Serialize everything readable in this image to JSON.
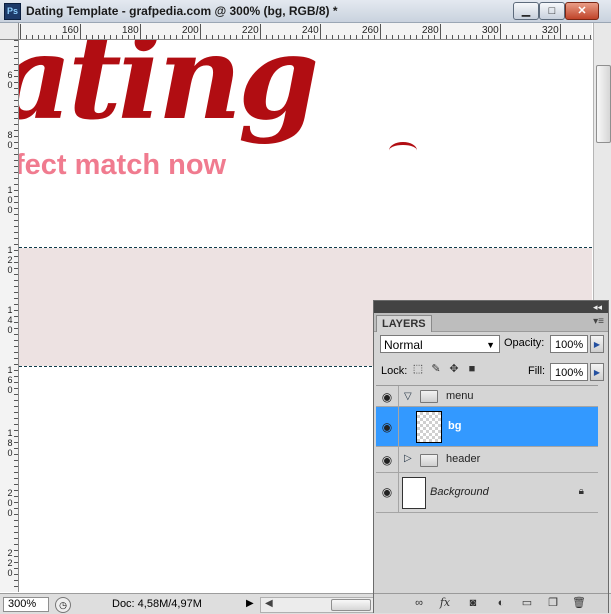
{
  "window": {
    "app_icon": "Ps",
    "title": "Dating Template - grafpedia.com @ 300% (bg, RGB/8) *",
    "buttons": {
      "minimize": "▁",
      "maximize": "□",
      "close": "✕"
    }
  },
  "ruler_top": {
    "labels": [
      "160",
      "180",
      "200",
      "220",
      "240",
      "260",
      "280",
      "300",
      "320"
    ]
  },
  "ruler_left": {
    "labels": [
      "60",
      "80",
      "100",
      "120",
      "140",
      "160",
      "180",
      "200",
      "220"
    ]
  },
  "canvas": {
    "logo_text": "ating",
    "tagline": "fect match now",
    "logo_color": "#b10d12",
    "tagline_color": "#f07b8f",
    "menu_band_color": "#ede2e2"
  },
  "status": {
    "zoom": "300%",
    "doc_info": "Doc: 4,58M/4,97M",
    "arrow": "▶",
    "scroll_left": "◀"
  },
  "layers_panel": {
    "tab_label": "LAYERS",
    "collapse_icon": "◂◂",
    "menu_icon": "▾≡",
    "blend_mode": "Normal",
    "opacity_label": "Opacity:",
    "opacity_value": "100%",
    "lock_label": "Lock:",
    "fill_label": "Fill:",
    "fill_value": "100%",
    "selected_color": "#3399ff",
    "layers": [
      {
        "name": "menu",
        "type": "group",
        "expanded": true,
        "visible": true
      },
      {
        "name": "bg",
        "type": "layer",
        "selected": true,
        "visible": true
      },
      {
        "name": "header",
        "type": "group",
        "expanded": false,
        "visible": true
      },
      {
        "name": "Background",
        "type": "layer",
        "locked": true,
        "visible": true
      }
    ]
  }
}
